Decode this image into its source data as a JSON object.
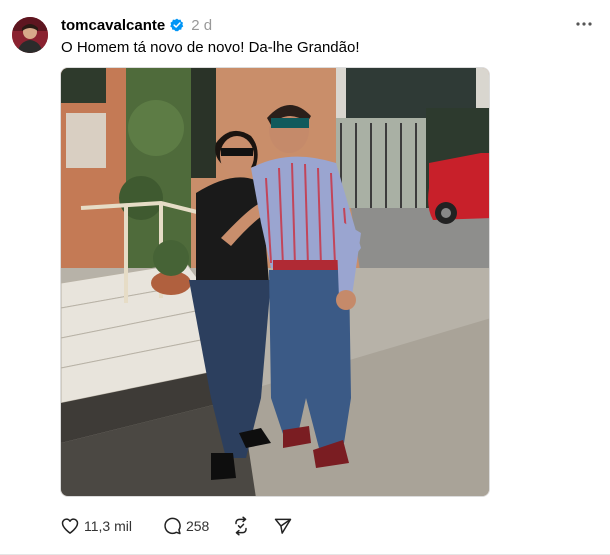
{
  "post": {
    "username": "tomcavalcante",
    "timestamp": "2 d",
    "verified": true,
    "caption": "O Homem tá novo de novo! Da-lhe Grandão!",
    "photo_alt": "",
    "actions": {
      "likes": "11,3 mil",
      "replies": "258"
    }
  },
  "icons": {
    "verified": "verified-badge-icon",
    "more": "more-options-icon",
    "like": "heart-icon",
    "reply": "comment-bubble-icon",
    "repost": "repost-icon",
    "share": "send-icon"
  },
  "colors": {
    "verified_blue": "#0095f6",
    "muted_text": "#999999",
    "divider": "#e5e5e5"
  }
}
